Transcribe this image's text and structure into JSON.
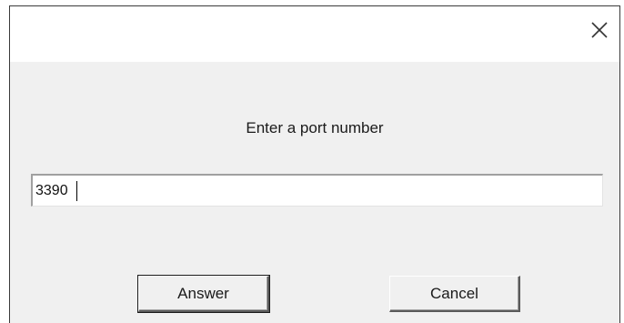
{
  "dialog": {
    "close_icon": "close-icon",
    "prompt": "Enter a port number",
    "input_value": "3390",
    "answer_label": "Answer",
    "cancel_label": "Cancel"
  }
}
